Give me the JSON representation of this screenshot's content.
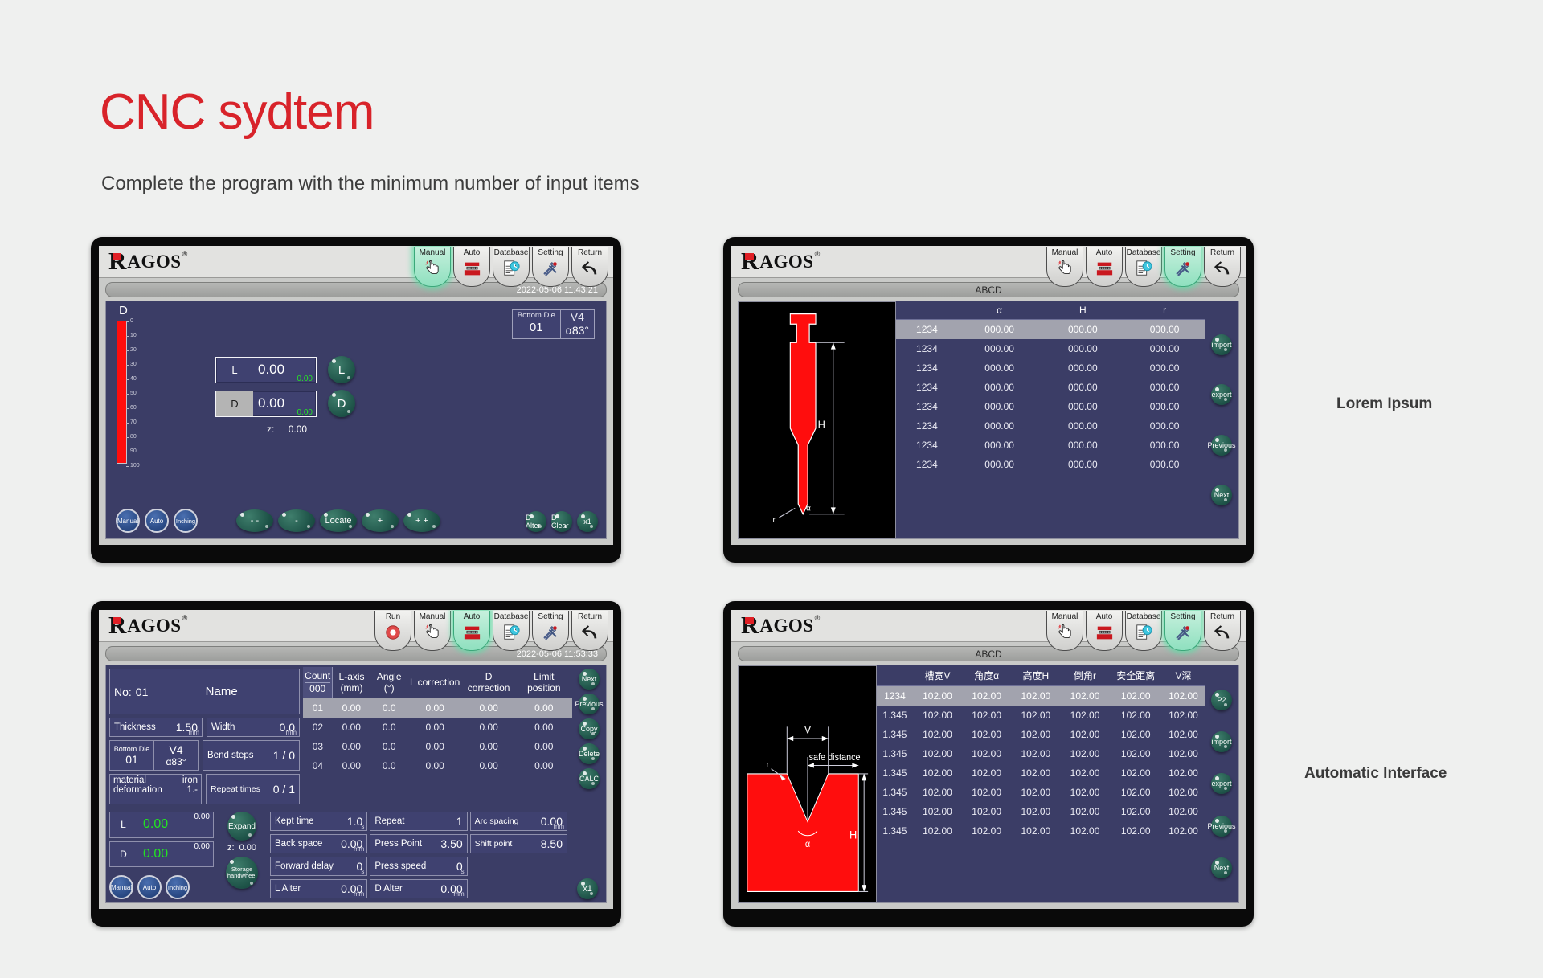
{
  "page": {
    "title": "CNC sydtem",
    "subtitle": "Complete the program with the minimum number of input items",
    "accent_color": "#d8232a",
    "bg_color": "#eff0ef"
  },
  "side_labels": {
    "panel2": "Lorem Ipsum",
    "panel4": "Automatic Interface"
  },
  "brand": {
    "r": "R",
    "rest": "AGOS",
    "reg": "®"
  },
  "panel1": {
    "nav": [
      {
        "label": "Manual",
        "icon": "hand-touch-icon",
        "active": true
      },
      {
        "label": "Auto",
        "icon": "press-machine-icon",
        "active": false
      },
      {
        "label": "Database",
        "icon": "document-clock-icon",
        "active": false
      },
      {
        "label": "Setting",
        "icon": "wrench-spanner-icon",
        "active": false
      },
      {
        "label": "Return",
        "icon": "back-arrow-icon",
        "active": false
      }
    ],
    "status_text": "2022-05-06 11:43:21",
    "gauge_label": "D",
    "gauge_ticks": [
      "0",
      "10",
      "20",
      "30",
      "40",
      "50",
      "60",
      "70",
      "80",
      "90",
      "100"
    ],
    "die": {
      "label": "Bottom Die",
      "no": "01",
      "v": "V4",
      "angle": "α83°"
    },
    "fields": [
      {
        "tag": "L",
        "value": "0.00",
        "sub": "0.00",
        "knob": "L",
        "highlight": false
      },
      {
        "tag": "D",
        "value": "0.00",
        "sub": "0.00",
        "knob": "D",
        "highlight": true
      }
    ],
    "z_label": "z:",
    "z_value": "0.00",
    "modes": [
      "Manual",
      "Auto",
      "Inching"
    ],
    "jog": [
      "- -",
      "-",
      "Locate",
      "+",
      "+ +"
    ],
    "actions": [
      "D Alter",
      "D Clear",
      "x1"
    ]
  },
  "panel2": {
    "nav": [
      {
        "label": "Manual",
        "icon": "hand-touch-icon",
        "active": false
      },
      {
        "label": "Auto",
        "icon": "press-machine-icon",
        "active": false
      },
      {
        "label": "Database",
        "icon": "document-clock-icon",
        "active": false
      },
      {
        "label": "Setting",
        "icon": "wrench-spanner-icon",
        "active": true
      },
      {
        "label": "Return",
        "icon": "back-arrow-icon",
        "active": false
      }
    ],
    "status_text": "ABCD",
    "shape": {
      "labels": [
        "H",
        "α",
        "r"
      ],
      "color": "#ff0d0d"
    },
    "table": {
      "columns": [
        "",
        "α",
        "H",
        "r"
      ],
      "rows": [
        {
          "id": "1234",
          "cells": [
            "000.00",
            "000.00",
            "000.00"
          ],
          "selected": true
        },
        {
          "id": "1234",
          "cells": [
            "000.00",
            "000.00",
            "000.00"
          ],
          "selected": false
        },
        {
          "id": "1234",
          "cells": [
            "000.00",
            "000.00",
            "000.00"
          ],
          "selected": false
        },
        {
          "id": "1234",
          "cells": [
            "000.00",
            "000.00",
            "000.00"
          ],
          "selected": false
        },
        {
          "id": "1234",
          "cells": [
            "000.00",
            "000.00",
            "000.00"
          ],
          "selected": false
        },
        {
          "id": "1234",
          "cells": [
            "000.00",
            "000.00",
            "000.00"
          ],
          "selected": false
        },
        {
          "id": "1234",
          "cells": [
            "000.00",
            "000.00",
            "000.00"
          ],
          "selected": false
        },
        {
          "id": "1234",
          "cells": [
            "000.00",
            "000.00",
            "000.00"
          ],
          "selected": false
        }
      ]
    },
    "side_buttons": [
      "import",
      "export",
      "Previous",
      "Next"
    ]
  },
  "panel3": {
    "nav": [
      {
        "label": "Run",
        "icon": "run-circle-icon",
        "active": false
      },
      {
        "label": "Manual",
        "icon": "hand-touch-icon",
        "active": false
      },
      {
        "label": "Auto",
        "icon": "press-machine-icon",
        "active": true
      },
      {
        "label": "Database",
        "icon": "document-clock-icon",
        "active": false
      },
      {
        "label": "Setting",
        "icon": "wrench-spanner-icon",
        "active": false
      },
      {
        "label": "Return",
        "icon": "back-arrow-icon",
        "active": false
      }
    ],
    "status_text": "2022-05-06 11:53:33",
    "header": {
      "no_label": "No:",
      "no_value": "01",
      "name": "Name"
    },
    "form": {
      "thickness": {
        "label": "Thickness",
        "value": "1.50",
        "unit": "mm"
      },
      "width": {
        "label": "Width",
        "value": "0.0",
        "unit": "mm"
      },
      "bottom_die": {
        "label": "Bottom Die",
        "no": "01",
        "v": "V4",
        "angle": "α83°"
      },
      "bend_steps": {
        "label": "Bend steps",
        "value": "1 / 0"
      },
      "material": {
        "label": "material",
        "value": "iron"
      },
      "deformation": {
        "label": "deformation",
        "value": "1.-"
      },
      "repeat_times": {
        "label": "Repeat times",
        "value": "0 / 1"
      }
    },
    "readouts": [
      {
        "tag": "L",
        "top": "0.00",
        "green": "0.00"
      },
      {
        "tag": "D",
        "top": "0.00",
        "green": "0.00"
      }
    ],
    "z_label": "z:",
    "z_value": "0.00",
    "expand_label": "Expand",
    "storage_label": "Storage handwheel",
    "modes": [
      "Manual",
      "Auto",
      "Inching"
    ],
    "params": [
      {
        "label": "Kept time",
        "value": "1.0",
        "unit": "s"
      },
      {
        "label": "Repeat",
        "value": "1",
        "unit": ""
      },
      {
        "label": "Arc spacing",
        "value": "0.00",
        "unit": "mm"
      },
      {
        "label": "Back space",
        "value": "0.00",
        "unit": "mm"
      },
      {
        "label": "Press Point",
        "value": "3.50",
        "unit": ""
      },
      {
        "label": "Shift point",
        "value": "8.50",
        "unit": ""
      },
      {
        "label": "Forward delay",
        "value": "0",
        "unit": "s"
      },
      {
        "label": "Press speed",
        "value": "0",
        "unit": "s"
      },
      {
        "label": "L Alter",
        "value": "0.00",
        "unit": "mm"
      },
      {
        "label": "D Alter",
        "value": "0.00",
        "unit": "mm"
      }
    ],
    "table": {
      "columns": [
        "Count",
        "L-axis (mm)",
        "Angle (°)",
        "L correction",
        "D correction",
        "Limit position"
      ],
      "count_value": "000",
      "rows": [
        {
          "cells": [
            "01",
            "0.00",
            "0.0",
            "0.00",
            "0.00",
            "0.00"
          ],
          "selected": true
        },
        {
          "cells": [
            "02",
            "0.00",
            "0.0",
            "0.00",
            "0.00",
            "0.00"
          ],
          "selected": false
        },
        {
          "cells": [
            "03",
            "0.00",
            "0.0",
            "0.00",
            "0.00",
            "0.00"
          ],
          "selected": false
        },
        {
          "cells": [
            "04",
            "0.00",
            "0.0",
            "0.00",
            "0.00",
            "0.00"
          ],
          "selected": false
        }
      ]
    },
    "side_buttons": [
      "Next",
      "Previous",
      "Copy",
      "Delete",
      "CALC"
    ],
    "multiplier_button": "x1"
  },
  "panel4": {
    "nav": [
      {
        "label": "Manual",
        "icon": "hand-touch-icon",
        "active": false
      },
      {
        "label": "Auto",
        "icon": "press-machine-icon",
        "active": false
      },
      {
        "label": "Database",
        "icon": "document-clock-icon",
        "active": false
      },
      {
        "label": "Setting",
        "icon": "wrench-spanner-icon",
        "active": true
      },
      {
        "label": "Return",
        "icon": "back-arrow-icon",
        "active": false
      }
    ],
    "status_text": "ABCD",
    "shape": {
      "labels": [
        "V",
        "safe distance",
        "H",
        "r",
        "α"
      ],
      "color": "#ff0d0d"
    },
    "table": {
      "columns": [
        "",
        "槽宽V",
        "角度α",
        "高度H",
        "倒角r",
        "安全距离",
        "V深"
      ],
      "rows": [
        {
          "id": "1234",
          "cells": [
            "102.00",
            "102.00",
            "102.00",
            "102.00",
            "102.00",
            "102.00"
          ],
          "selected": true
        },
        {
          "id": "1.345",
          "cells": [
            "102.00",
            "102.00",
            "102.00",
            "102.00",
            "102.00",
            "102.00"
          ],
          "selected": false
        },
        {
          "id": "1.345",
          "cells": [
            "102.00",
            "102.00",
            "102.00",
            "102.00",
            "102.00",
            "102.00"
          ],
          "selected": false
        },
        {
          "id": "1.345",
          "cells": [
            "102.00",
            "102.00",
            "102.00",
            "102.00",
            "102.00",
            "102.00"
          ],
          "selected": false
        },
        {
          "id": "1.345",
          "cells": [
            "102.00",
            "102.00",
            "102.00",
            "102.00",
            "102.00",
            "102.00"
          ],
          "selected": false
        },
        {
          "id": "1.345",
          "cells": [
            "102.00",
            "102.00",
            "102.00",
            "102.00",
            "102.00",
            "102.00"
          ],
          "selected": false
        },
        {
          "id": "1.345",
          "cells": [
            "102.00",
            "102.00",
            "102.00",
            "102.00",
            "102.00",
            "102.00"
          ],
          "selected": false
        },
        {
          "id": "1.345",
          "cells": [
            "102.00",
            "102.00",
            "102.00",
            "102.00",
            "102.00",
            "102.00"
          ],
          "selected": false
        }
      ]
    },
    "side_buttons": [
      "P2",
      "import",
      "export",
      "Previous",
      "Next"
    ]
  }
}
